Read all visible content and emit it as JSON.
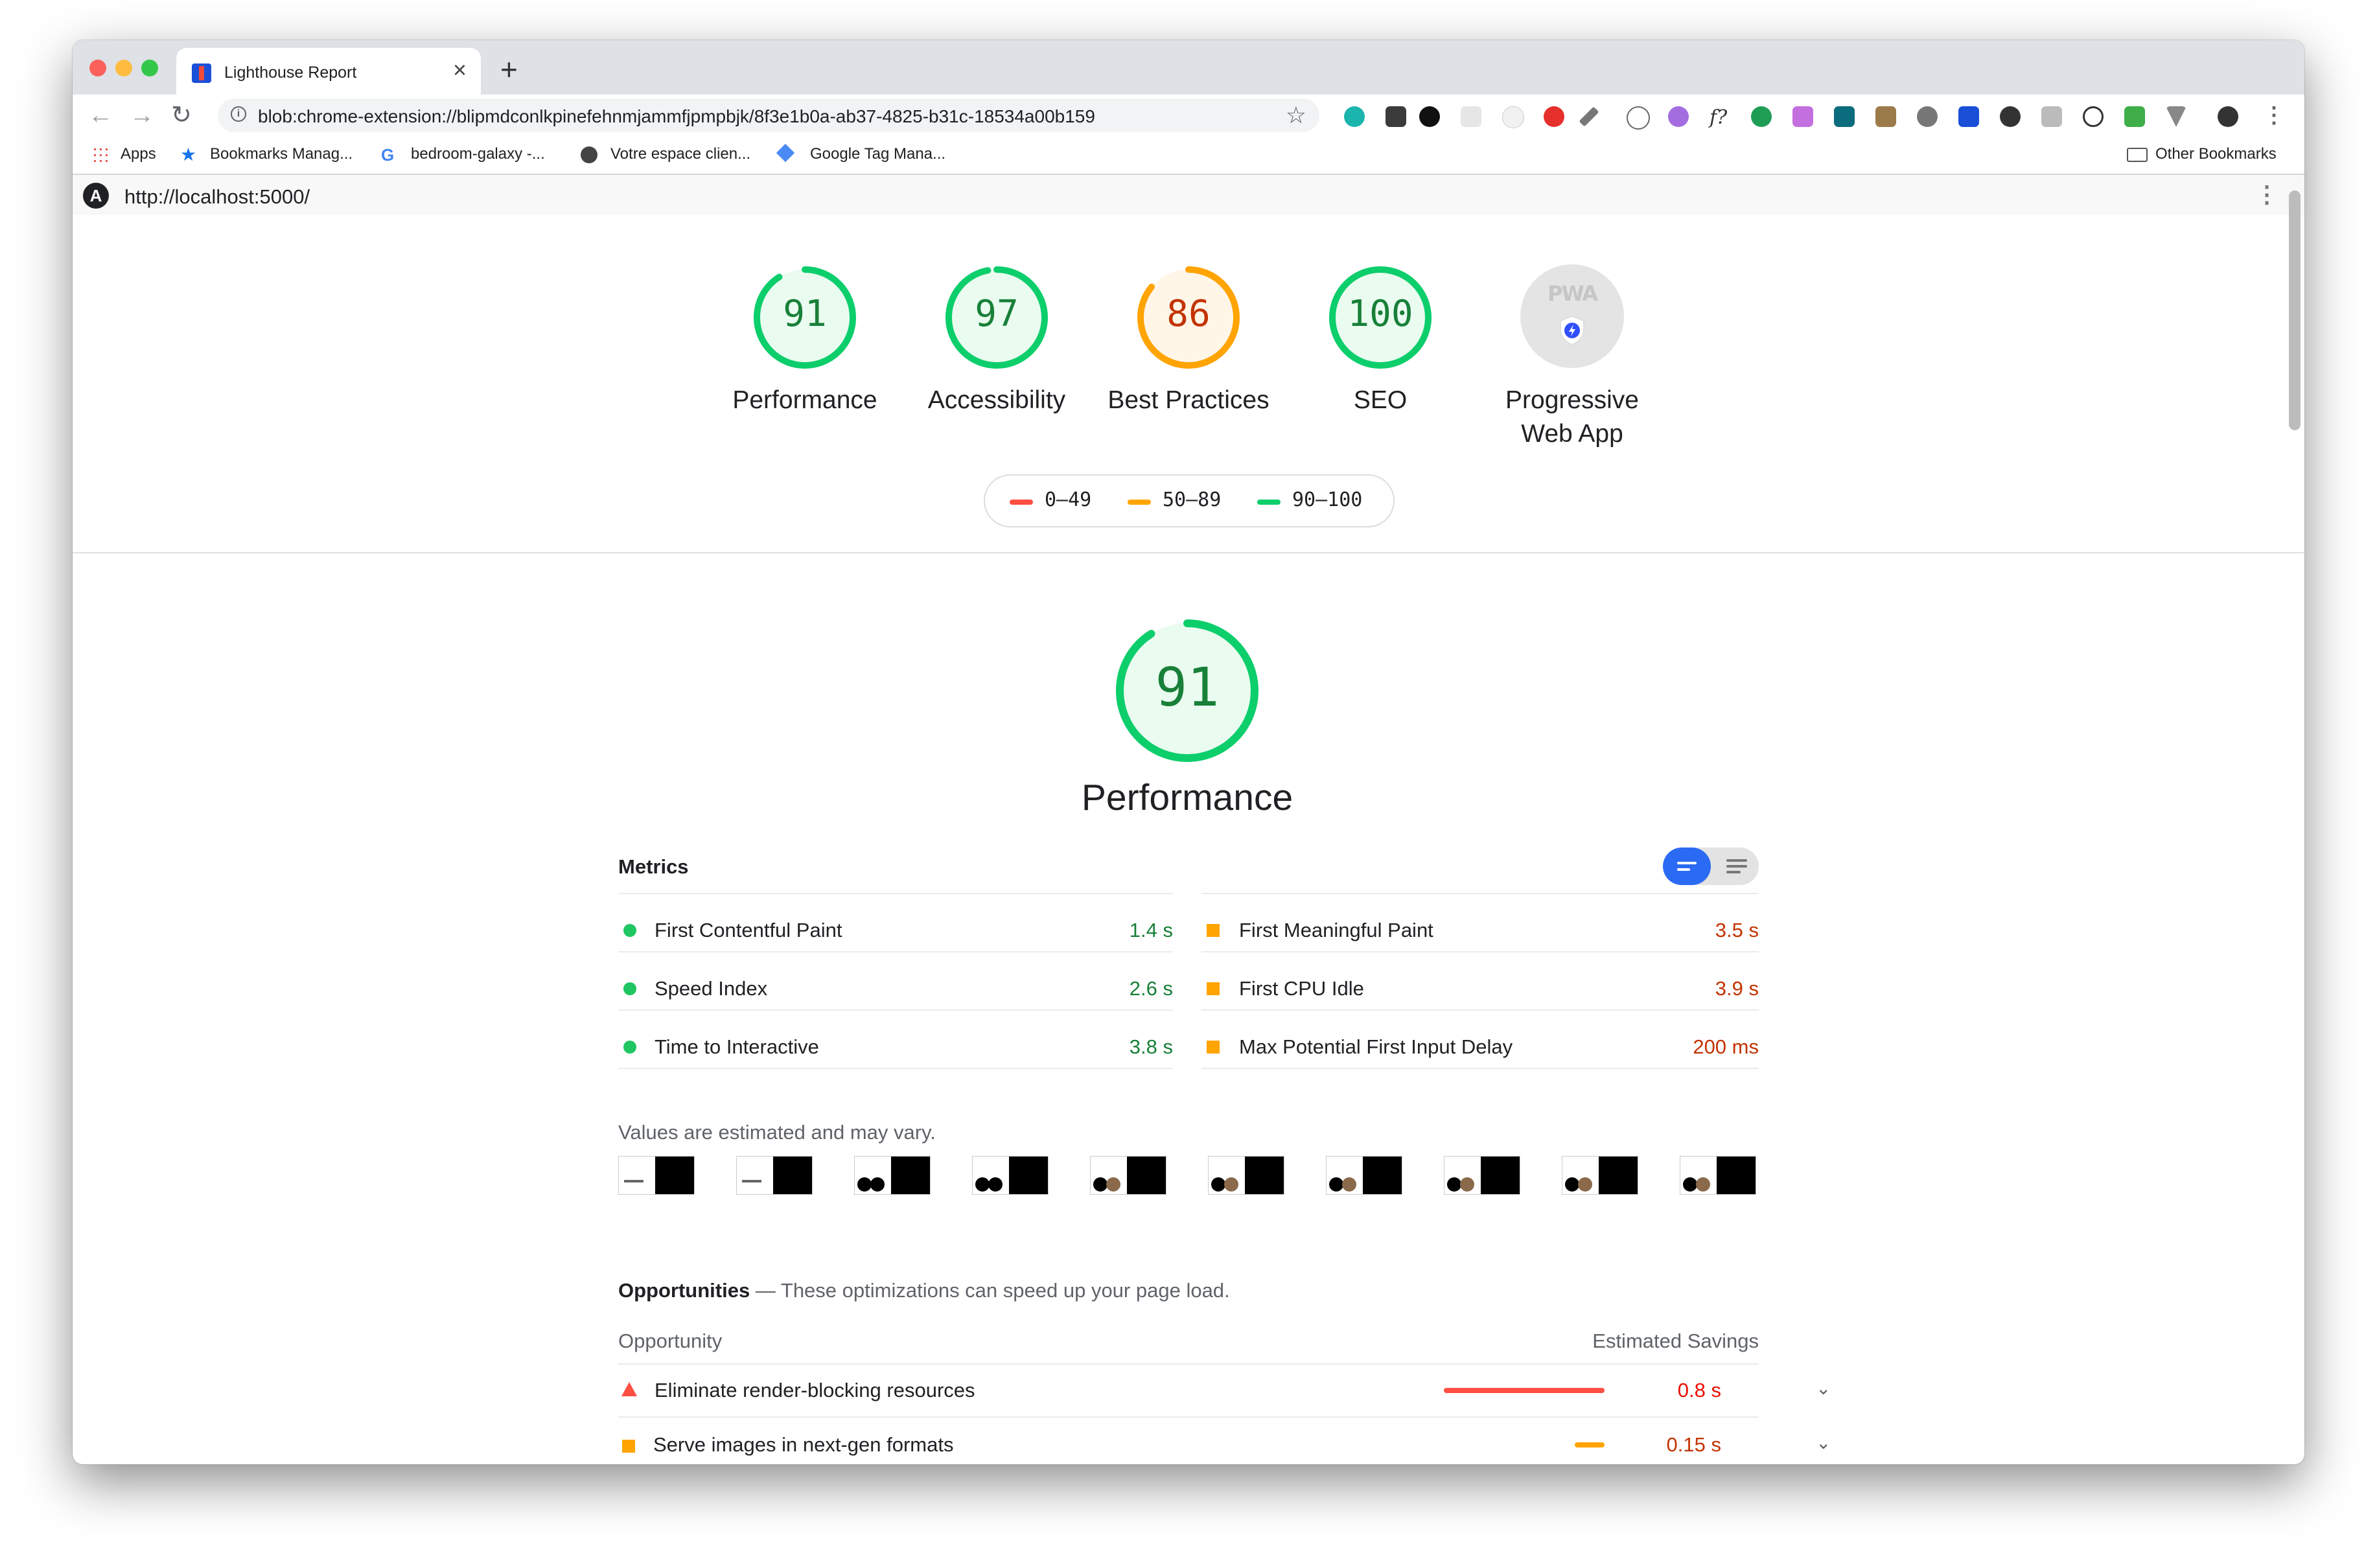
{
  "browser": {
    "tab_title": "Lighthouse Report",
    "tab_close": "×",
    "new_tab": "+",
    "url": "blob:chrome-extension://blipmdconlkpinefehnmjammfjpmpbjk/8f3e1b0a-ab37-4825-b31c-18534a00b159",
    "bookmarks": [
      "Apps",
      "Bookmarks Manag...",
      "bedroom-galaxy -...",
      "Votre espace clien...",
      "Google Tag Mana..."
    ],
    "other_bookmarks": "Other Bookmarks"
  },
  "report": {
    "page_url": "http://localhost:5000/",
    "gauges": [
      {
        "label": "Performance",
        "score": "91",
        "value": 91,
        "color": "#0cce6b"
      },
      {
        "label": "Accessibility",
        "score": "97",
        "value": 97,
        "color": "#0cce6b"
      },
      {
        "label": "Best Practices",
        "score": "86",
        "value": 86,
        "color": "#ffa400"
      },
      {
        "label": "SEO",
        "score": "100",
        "value": 100,
        "color": "#0cce6b"
      }
    ],
    "pwa": {
      "label_line1": "Progressive",
      "label_line2": "Web App",
      "logo_text": "PWA"
    },
    "legend": [
      "0–49",
      "50–89",
      "90–100"
    ],
    "legend_colors": [
      "#ff4e42",
      "#ffa400",
      "#0cce6b"
    ],
    "category": {
      "title": "Performance",
      "score": "91",
      "value": 91
    },
    "metrics_title": "Metrics",
    "metrics_left": [
      {
        "label": "First Contentful Paint",
        "value": "1.4 s"
      },
      {
        "label": "Speed Index",
        "value": "2.6 s"
      },
      {
        "label": "Time to Interactive",
        "value": "3.8 s"
      }
    ],
    "metrics_right": [
      {
        "label": "First Meaningful Paint",
        "value": "3.5 s"
      },
      {
        "label": "First CPU Idle",
        "value": "3.9 s"
      },
      {
        "label": "Max Potential First Input Delay",
        "value": "200 ms"
      }
    ],
    "note": "Values are estimated and may vary.",
    "opportunities": {
      "title": "Opportunities",
      "subtitle": " — These optimizations can speed up your page load.",
      "col_opportunity": "Opportunity",
      "col_savings": "Estimated Savings",
      "items": [
        {
          "label": "Eliminate render-blocking resources",
          "value": "0.8 s",
          "savings": 0.8
        },
        {
          "label": "Serve images in next-gen formats",
          "value": "0.15 s",
          "savings": 0.15
        }
      ]
    }
  },
  "colors": {
    "pass": "#0cce6b",
    "average": "#ffa400",
    "fail": "#ff4e42",
    "pass_text": "#188038",
    "average_text": "#c33300",
    "fail_text": "#eb0f00"
  }
}
